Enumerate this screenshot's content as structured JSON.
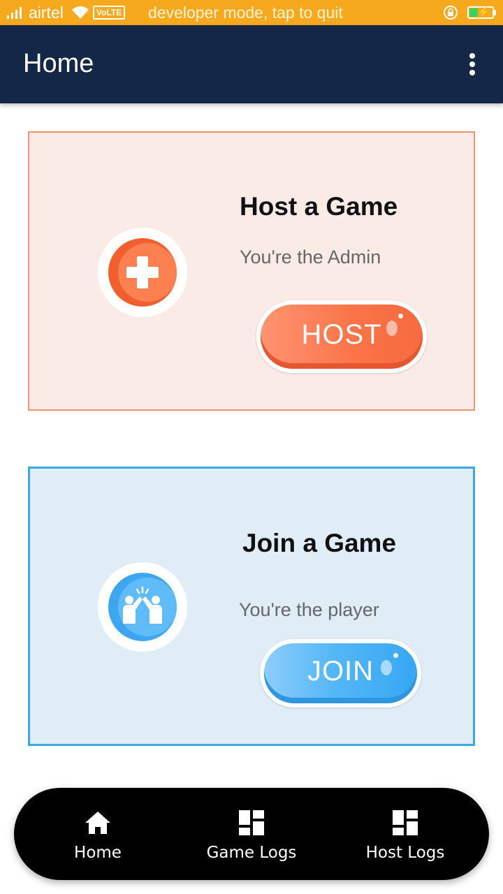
{
  "status_bar": {
    "carrier": "airtel",
    "network_badge": "VoLTE",
    "message": "developer mode, tap to quit",
    "icons": [
      "signal-icon",
      "wifi-icon",
      "rotation-lock-icon",
      "battery-charging-icon"
    ],
    "background_color": "#f6a91d"
  },
  "app_bar": {
    "title": "Home",
    "menu_icon": "overflow-menu-icon",
    "background_color": "#152746"
  },
  "cards": [
    {
      "title": "Host a Game",
      "subtitle": "You're the Admin",
      "button_label": "HOST",
      "icon": "plus-icon",
      "accent_color": "#f66a3f",
      "background_color": "#fbebe7"
    },
    {
      "title": "Join a Game",
      "subtitle": "You're the player",
      "button_label": "JOIN",
      "icon": "high-five-icon",
      "accent_color": "#36a7f3",
      "background_color": "#e0edf7"
    }
  ],
  "bottom_nav": {
    "items": [
      {
        "label": "Home",
        "icon": "home-icon"
      },
      {
        "label": "Game Logs",
        "icon": "dashboard-icon"
      },
      {
        "label": "Host Logs",
        "icon": "dashboard-icon"
      }
    ]
  }
}
